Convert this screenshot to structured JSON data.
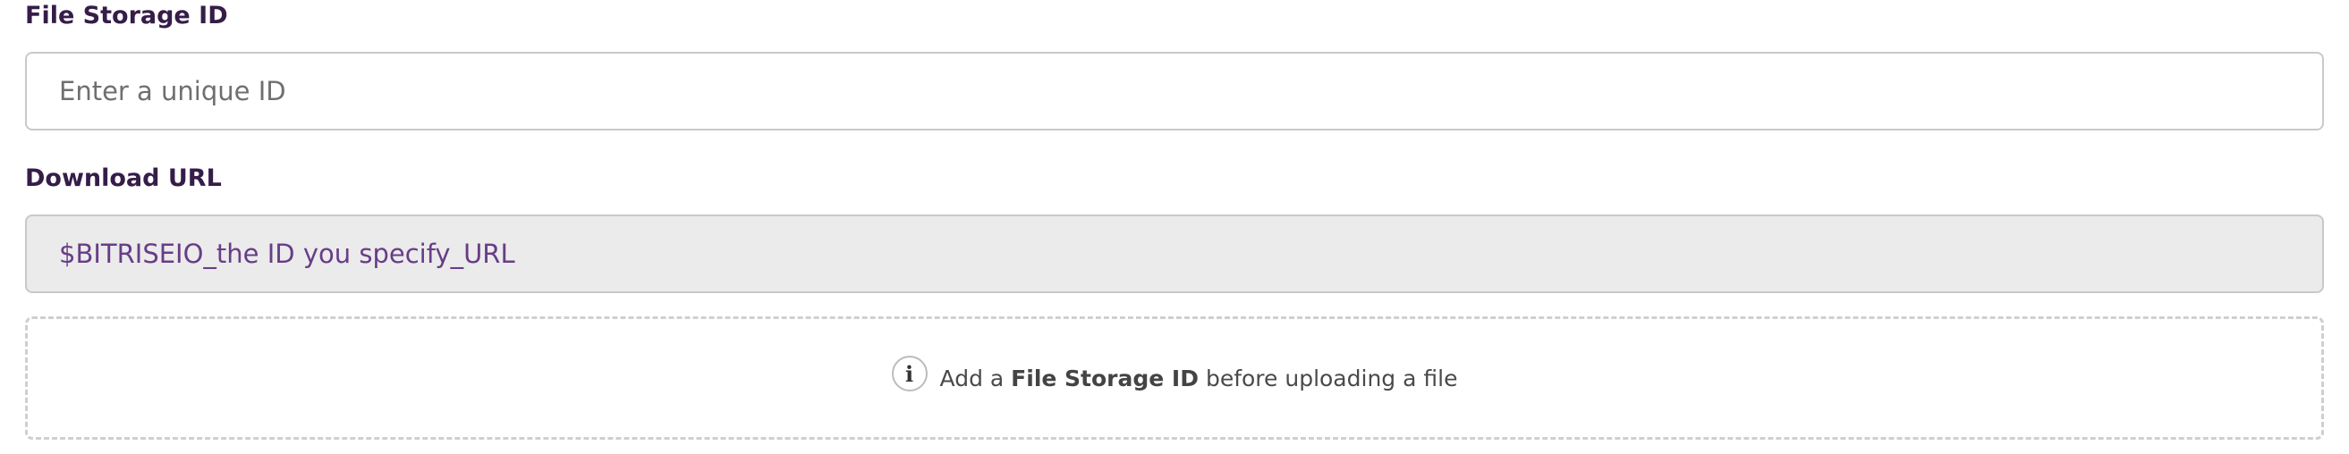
{
  "file_storage": {
    "label": "File Storage ID",
    "input": {
      "placeholder": "Enter a unique ID",
      "value": ""
    }
  },
  "download_url": {
    "label": "Download URL",
    "value": "$BITRISEIO_the ID you specify_URL"
  },
  "dropzone": {
    "icon": "info-icon",
    "message_prefix": "Add a",
    "message_bold": "File Storage ID",
    "message_suffix": "before uploading a file"
  }
}
